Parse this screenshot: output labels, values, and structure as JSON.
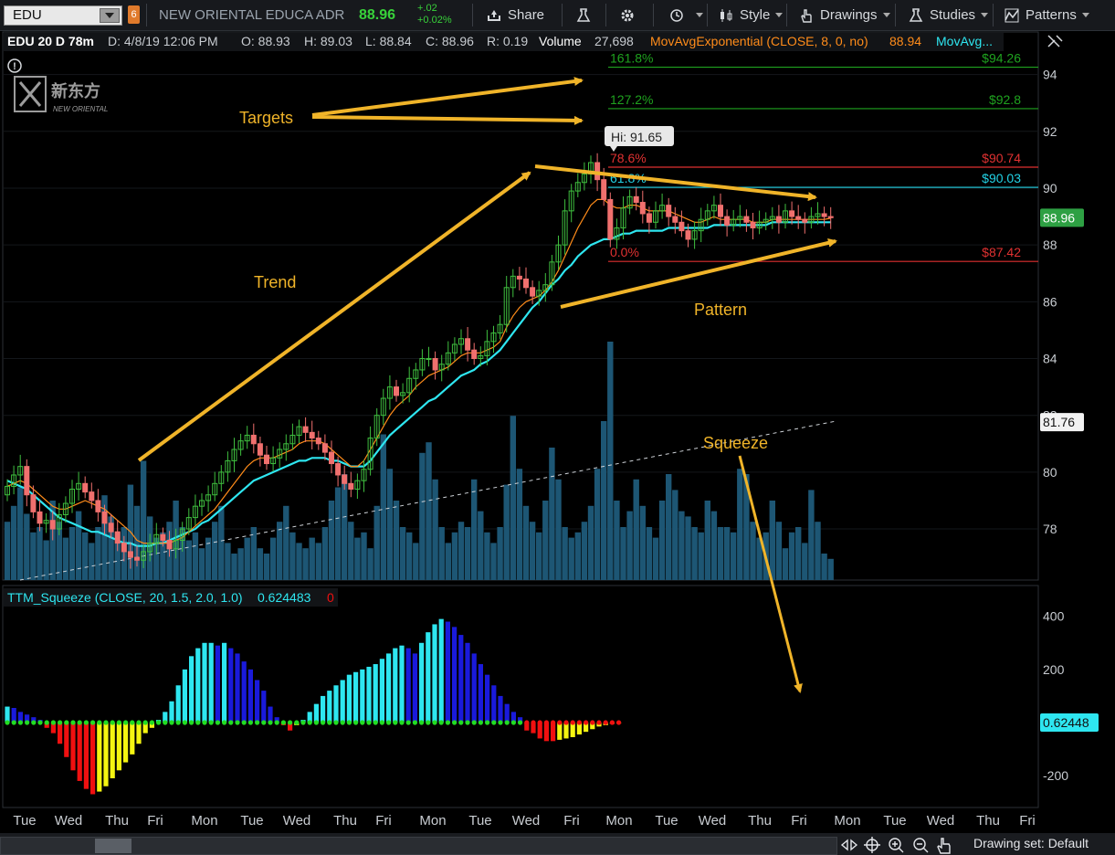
{
  "toolbar": {
    "symbol": "EDU",
    "link_badge": "6",
    "company": "NEW ORIENTAL EDUCA ADR",
    "last": "88.96",
    "net_change": "+.02",
    "pct_change": "+0.02%",
    "share_label": "Share",
    "style_label": "Style",
    "drawings_label": "Drawings",
    "studies_label": "Studies",
    "patterns_label": "Patterns"
  },
  "header": {
    "aggregation": "EDU 20 D 78m",
    "date": "D: 4/8/19 12:06 PM",
    "open": "O: 88.93",
    "high": "H: 89.03",
    "low": "L: 88.84",
    "close": "C: 88.96",
    "range": "R: 0.19",
    "volume_label": "Volume",
    "volume_value": "27,698",
    "ema_label": "MovAvgExponential (CLOSE, 8, 0, no)",
    "ema_value": "88.94",
    "ema2_label": "MovAvg..."
  },
  "squeeze_header": {
    "label": "TTM_Squeeze (CLOSE, 20, 1.5, 2.0, 1.0)",
    "value": "0.624483",
    "value2": "0"
  },
  "annotations": {
    "targets": "Targets",
    "trend": "Trend",
    "pattern": "Pattern",
    "squeeze": "Squeeze",
    "hi_label": "Hi: 91.65"
  },
  "statusbar": {
    "drawing_set": "Drawing set: Default"
  },
  "colors": {
    "up": "#3fbf3f",
    "down": "#f0706e",
    "ema_fast": "#ff8c1a",
    "ema_slow": "#2ee6f0",
    "volume": "#1d5674",
    "annotation": "#f0b429",
    "fib_green": "#1fa31f",
    "fib_red": "#e03131",
    "fib_cyan": "#22d3e6",
    "sq_cyan": "#2ee6f0",
    "sq_blue": "#1a1adb",
    "sq_red": "#f01010",
    "sq_yellow": "#f5f511",
    "sq_dot": "#22dd22"
  },
  "chart_data": [
    {
      "type": "candlestick",
      "ylim": [
        76.2,
        95.5
      ],
      "y_ticks": [
        78,
        80,
        82,
        84,
        86,
        88,
        90,
        92,
        94
      ],
      "x_labels": [
        "Tue",
        "Wed",
        "Thu",
        "Fri",
        "Mon",
        "Tue",
        "Wed",
        "Thu",
        "Fri",
        "Mon",
        "Tue",
        "Wed",
        "Fri",
        "Mon",
        "Tue",
        "Wed",
        "Thu",
        "Fri",
        "Mon",
        "Tue",
        "Wed",
        "Thu",
        "Fri"
      ],
      "last_price": "88.96",
      "dashed_line_tag": "81.76",
      "fib_levels": [
        {
          "pct": "161.8%",
          "price": 94.26,
          "label": "$94.26"
        },
        {
          "pct": "127.2%",
          "price": 92.8,
          "label": "$92.8"
        },
        {
          "pct": "78.6%",
          "price": 90.74,
          "label": "$90.74"
        },
        {
          "pct": "61.8%",
          "price": 90.03,
          "label": "$90.03"
        },
        {
          "pct": "0.0%",
          "price": 87.42,
          "label": "$87.42"
        }
      ],
      "hi": 91.65,
      "closes": [
        79.5,
        79.9,
        80.2,
        79.2,
        78.6,
        78.2,
        78.3,
        78.0,
        78.5,
        78.9,
        79.4,
        79.6,
        79.3,
        79.0,
        78.6,
        78.2,
        77.9,
        77.5,
        77.2,
        77.0,
        76.9,
        77.2,
        77.5,
        77.8,
        77.6,
        77.3,
        77.6,
        78.0,
        78.4,
        78.8,
        79.0,
        79.2,
        79.6,
        80.0,
        80.4,
        80.8,
        81.1,
        81.3,
        81.0,
        80.6,
        80.3,
        80.5,
        80.8,
        81.0,
        81.3,
        81.6,
        81.4,
        81.2,
        81.0,
        80.7,
        80.3,
        79.9,
        79.6,
        79.4,
        79.7,
        80.1,
        81.2,
        82.0,
        82.6,
        83.0,
        82.7,
        82.8,
        83.3,
        83.6,
        84.0,
        84.0,
        83.6,
        83.8,
        84.2,
        84.5,
        84.7,
        84.3,
        84.0,
        84.1,
        84.6,
        84.9,
        85.2,
        86.5,
        86.9,
        86.8,
        86.5,
        86.2,
        86.4,
        86.6,
        87.4,
        88.0,
        89.2,
        89.9,
        90.2,
        90.5,
        90.9,
        90.3,
        89.6,
        88.2,
        88.6,
        89.3,
        89.7,
        89.5,
        89.1,
        88.8,
        89.2,
        89.4,
        89.0,
        88.8,
        88.5,
        88.2,
        88.5,
        88.9,
        89.2,
        89.4,
        89.0,
        88.7,
        88.9,
        89.0,
        88.8,
        88.6,
        88.8,
        88.9,
        89.0,
        88.8,
        89.2,
        89.0,
        88.9,
        88.8,
        89.0,
        89.1,
        89.0,
        88.96
      ],
      "ema_fast": [
        79.5,
        79.6,
        79.7,
        79.6,
        79.4,
        79.2,
        79.0,
        78.8,
        78.7,
        78.7,
        78.8,
        78.9,
        79.0,
        78.9,
        78.8,
        78.7,
        78.5,
        78.3,
        78.1,
        77.9,
        77.6,
        77.5,
        77.5,
        77.5,
        77.5,
        77.5,
        77.6,
        77.7,
        77.9,
        78.1,
        78.3,
        78.5,
        78.7,
        79.0,
        79.3,
        79.6,
        79.9,
        80.2,
        80.4,
        80.5,
        80.5,
        80.5,
        80.6,
        80.7,
        80.8,
        81.0,
        81.1,
        81.1,
        81.1,
        81.0,
        80.8,
        80.6,
        80.4,
        80.2,
        80.2,
        80.4,
        80.8,
        81.2,
        81.6,
        82.0,
        82.3,
        82.5,
        82.7,
        83.0,
        83.2,
        83.4,
        83.5,
        83.6,
        83.7,
        83.9,
        84.1,
        84.2,
        84.2,
        84.2,
        84.3,
        84.4,
        84.6,
        85.1,
        85.5,
        85.8,
        86.0,
        86.1,
        86.2,
        86.4,
        86.7,
        87.1,
        87.6,
        88.1,
        88.6,
        89.0,
        89.4,
        89.6,
        89.6,
        89.4,
        89.3,
        89.3,
        89.4,
        89.4,
        89.3,
        89.2,
        89.2,
        89.2,
        89.2,
        89.1,
        89.0,
        88.9,
        88.8,
        88.8,
        88.9,
        89.0,
        88.9,
        88.9,
        88.9,
        88.9,
        88.9,
        88.8,
        88.8,
        88.8,
        88.9,
        88.9,
        88.9,
        88.9,
        88.9,
        88.9,
        88.9,
        88.9,
        88.9,
        88.94
      ],
      "ema_slow": [
        79.7,
        79.6,
        79.5,
        79.4,
        79.2,
        79.0,
        78.8,
        78.6,
        78.4,
        78.3,
        78.2,
        78.1,
        78.0,
        77.9,
        77.9,
        77.8,
        77.7,
        77.6,
        77.5,
        77.5,
        77.4,
        77.4,
        77.4,
        77.5,
        77.5,
        77.6,
        77.7,
        77.8,
        77.9,
        78.0,
        78.2,
        78.3,
        78.5,
        78.7,
        78.9,
        79.1,
        79.3,
        79.5,
        79.7,
        79.8,
        79.9,
        80.0,
        80.1,
        80.2,
        80.3,
        80.4,
        80.4,
        80.5,
        80.5,
        80.5,
        80.4,
        80.4,
        80.3,
        80.2,
        80.2,
        80.2,
        80.4,
        80.7,
        81.0,
        81.3,
        81.5,
        81.7,
        81.9,
        82.1,
        82.3,
        82.5,
        82.6,
        82.8,
        83.0,
        83.2,
        83.4,
        83.5,
        83.6,
        83.8,
        83.9,
        84.1,
        84.3,
        84.6,
        84.9,
        85.2,
        85.5,
        85.8,
        86.0,
        86.3,
        86.6,
        86.8,
        87.1,
        87.3,
        87.6,
        87.8,
        88.0,
        88.1,
        88.2,
        88.2,
        88.3,
        88.4,
        88.4,
        88.5,
        88.5,
        88.5,
        88.5,
        88.5,
        88.6,
        88.6,
        88.6,
        88.6,
        88.6,
        88.6,
        88.6,
        88.7,
        88.7,
        88.7,
        88.7,
        88.7,
        88.7,
        88.7,
        88.7,
        88.7,
        88.8,
        88.8,
        88.8,
        88.8,
        88.8,
        88.8,
        88.8,
        88.8,
        88.8,
        88.8
      ],
      "volume": [
        0.22,
        0.28,
        0.35,
        0.25,
        0.18,
        0.2,
        0.15,
        0.3,
        0.22,
        0.16,
        0.2,
        0.26,
        0.18,
        0.14,
        0.2,
        0.32,
        0.24,
        0.18,
        0.2,
        0.36,
        0.28,
        0.45,
        0.24,
        0.16,
        0.18,
        0.22,
        0.3,
        0.2,
        0.15,
        0.18,
        0.12,
        0.16,
        0.22,
        0.28,
        0.14,
        0.1,
        0.12,
        0.16,
        0.2,
        0.12,
        0.1,
        0.16,
        0.22,
        0.28,
        0.18,
        0.14,
        0.12,
        0.16,
        0.14,
        0.2,
        0.3,
        0.35,
        0.4,
        0.22,
        0.16,
        0.18,
        0.12,
        0.28,
        0.55,
        0.42,
        0.3,
        0.2,
        0.18,
        0.14,
        0.48,
        0.52,
        0.38,
        0.2,
        0.14,
        0.18,
        0.22,
        0.2,
        0.38,
        0.26,
        0.18,
        0.14,
        0.2,
        0.36,
        0.62,
        0.42,
        0.28,
        0.22,
        0.18,
        0.3,
        0.5,
        0.38,
        0.2,
        0.16,
        0.18,
        0.22,
        0.28,
        0.42,
        0.6,
        0.9,
        0.3,
        0.2,
        0.26,
        0.38,
        0.28,
        0.2,
        0.16,
        0.3,
        0.4,
        0.34,
        0.26,
        0.24,
        0.2,
        0.18,
        0.3,
        0.26,
        0.2,
        0.2,
        0.18,
        0.42,
        0.4,
        0.22,
        0.16,
        0.18,
        0.3,
        0.22,
        0.12,
        0.18,
        0.2,
        0.14,
        0.34,
        0.22,
        0.1,
        0.08
      ]
    },
    {
      "type": "bar",
      "name": "TTM_Squeeze",
      "ylim": [
        -320,
        430
      ],
      "y_ticks": [
        400,
        200,
        -200
      ],
      "last_value_tag": "0.62448",
      "values": [
        60,
        55,
        40,
        30,
        20,
        10,
        -20,
        -40,
        -80,
        -130,
        -180,
        -220,
        -250,
        -270,
        -260,
        -240,
        -210,
        -180,
        -150,
        -120,
        -80,
        -40,
        -20,
        10,
        40,
        80,
        140,
        200,
        250,
        280,
        300,
        300,
        290,
        300,
        280,
        260,
        230,
        200,
        160,
        120,
        60,
        20,
        -10,
        -30,
        -10,
        10,
        40,
        70,
        100,
        120,
        140,
        160,
        180,
        190,
        200,
        210,
        220,
        240,
        260,
        280,
        290,
        280,
        260,
        300,
        340,
        370,
        390,
        380,
        360,
        330,
        300,
        260,
        220,
        180,
        140,
        100,
        70,
        40,
        20,
        -30,
        -40,
        -60,
        -70,
        -70,
        -65,
        -60,
        -55,
        -45,
        -35,
        -25,
        -15,
        -10,
        -5,
        -3
      ]
    }
  ]
}
